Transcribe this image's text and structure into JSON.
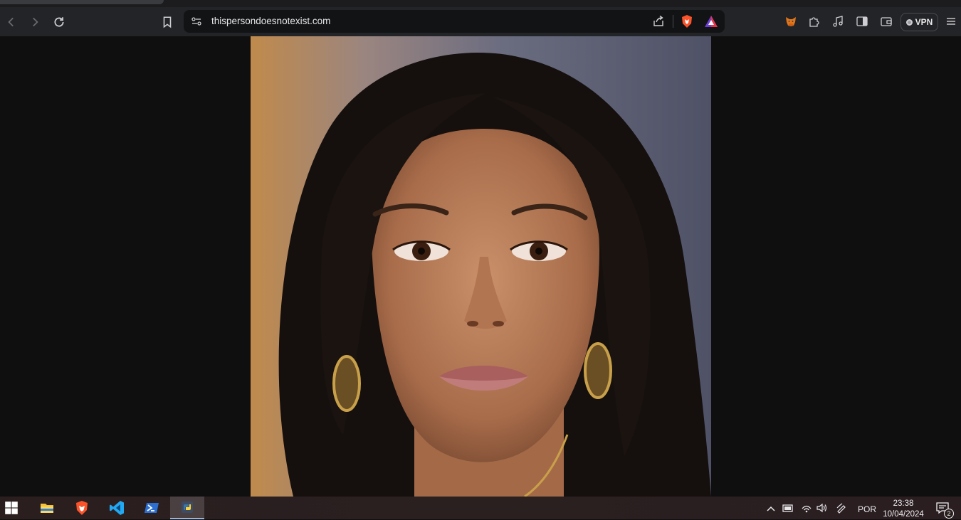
{
  "browser": {
    "url": "thispersondoesnotexist.com",
    "vpn_label": "VPN",
    "icons": {
      "back": "chevron-left-icon",
      "forward": "chevron-right-icon",
      "reload": "reload-icon",
      "bookmark": "bookmark-icon",
      "site_info": "site-settings-icon",
      "share": "share-icon",
      "shields": "brave-shields-icon",
      "rewards": "brave-rewards-icon",
      "metamask": "metamask-fox-icon",
      "extensions": "puzzle-icon",
      "media": "music-note-icon",
      "sidebar": "sidebar-icon",
      "wallet": "wallet-icon",
      "menu": "hamburger-menu-icon"
    }
  },
  "content": {
    "image_alt": "Generated portrait photo of a woman with long dark hair and gold earrings"
  },
  "taskbar": {
    "apps": [
      "windows-start",
      "file-explorer",
      "brave-browser",
      "vs-code",
      "powershell",
      "python"
    ],
    "language": "POR",
    "time": "23:38",
    "date": "10/04/2024",
    "notification_count": "2"
  },
  "colors": {
    "toolbar": "#232427",
    "urlbar": "#121315",
    "viewport": "#0f0f0f",
    "brave_orange": "#fb542b",
    "taskbar": "#2a1f1f"
  }
}
